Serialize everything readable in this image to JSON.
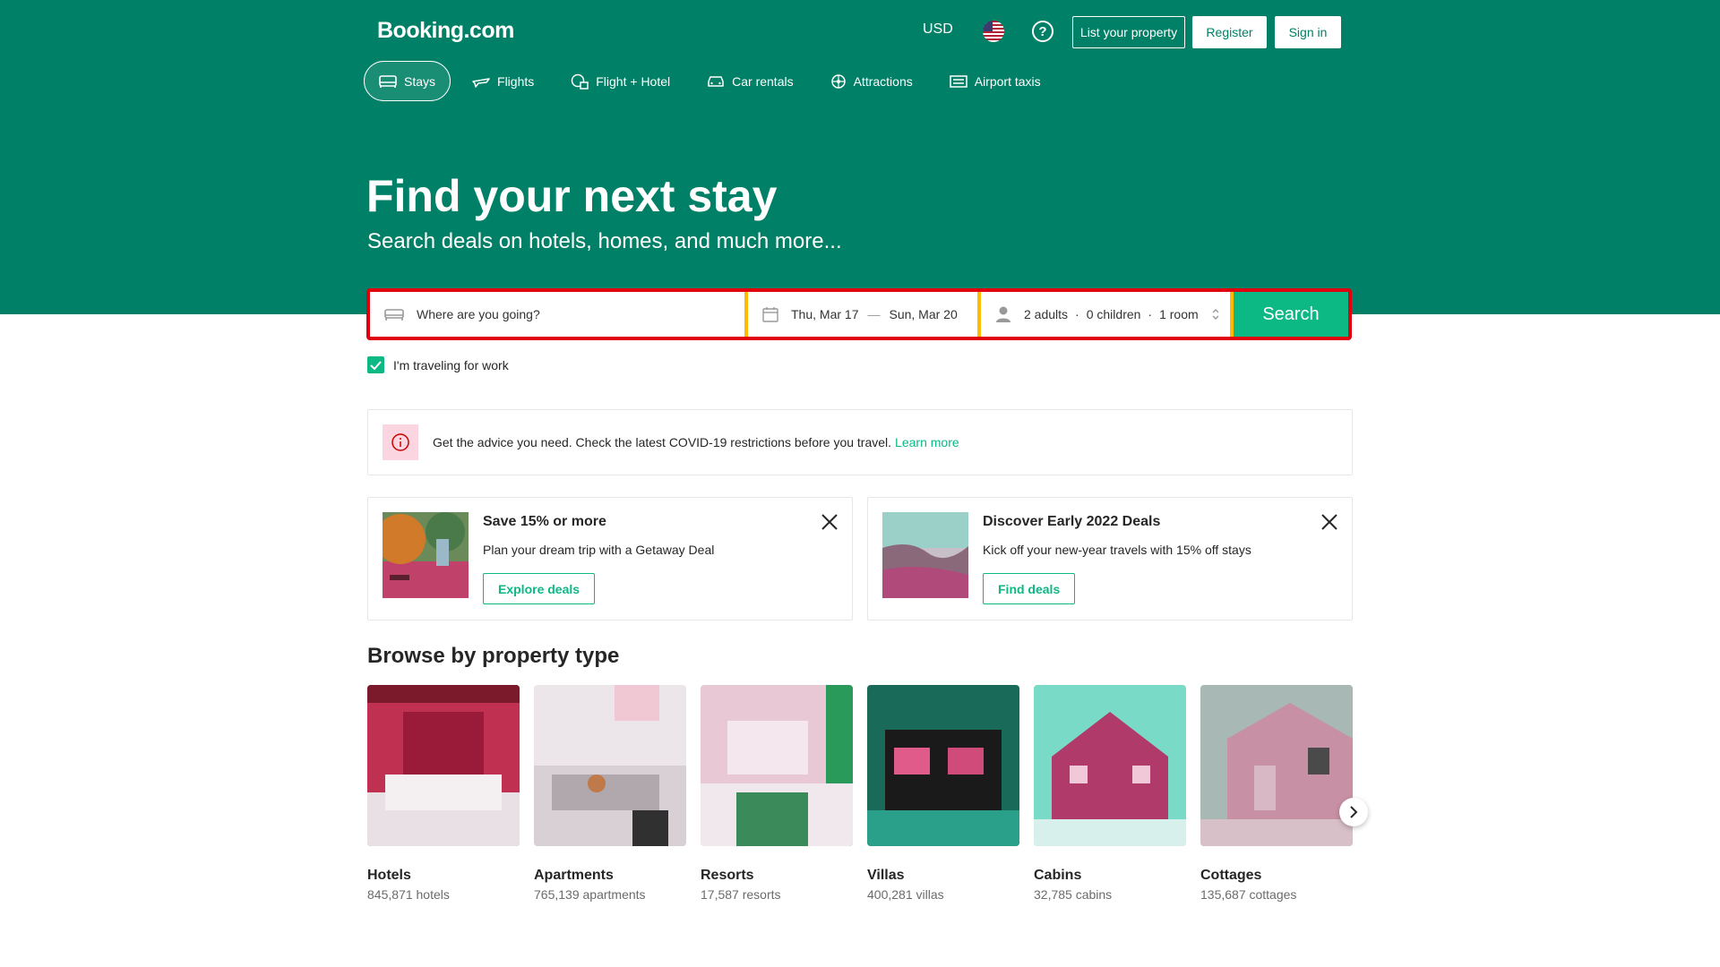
{
  "header": {
    "logo": "Booking.com",
    "currency": "USD",
    "help_label": "?",
    "list_property": "List your property",
    "register": "Register",
    "sign_in": "Sign in"
  },
  "nav": {
    "items": [
      {
        "label": "Stays",
        "icon": "bed-icon",
        "active": true
      },
      {
        "label": "Flights",
        "icon": "plane-icon"
      },
      {
        "label": "Flight + Hotel",
        "icon": "flight-hotel-icon"
      },
      {
        "label": "Car rentals",
        "icon": "car-icon"
      },
      {
        "label": "Attractions",
        "icon": "attractions-icon"
      },
      {
        "label": "Airport taxis",
        "icon": "taxi-icon"
      }
    ]
  },
  "hero": {
    "title": "Find your next stay",
    "subtitle": "Search deals on hotels, homes, and much more..."
  },
  "search": {
    "destination_placeholder": "Where are you going?",
    "checkin": "Thu, Mar 17",
    "date_separator": "—",
    "checkout": "Sun, Mar 20",
    "adults": "2 adults",
    "children": "0 children",
    "rooms": "1 room",
    "occ_separator": "·",
    "button": "Search",
    "work_label": "I'm traveling for work",
    "work_checked": true
  },
  "banner": {
    "text": "Get the advice you need. Check the latest COVID-19 restrictions before you travel.",
    "link": "Learn more"
  },
  "promos": [
    {
      "title": "Save 15% or more",
      "text": "Plan your dream trip with a Getaway Deal",
      "button": "Explore deals"
    },
    {
      "title": "Discover Early 2022 Deals",
      "text": "Kick off your new-year travels with 15% off stays",
      "button": "Find deals"
    }
  ],
  "browse": {
    "title": "Browse by property type",
    "types": [
      {
        "name": "Hotels",
        "count": "845,871 hotels"
      },
      {
        "name": "Apartments",
        "count": "765,139 apartments"
      },
      {
        "name": "Resorts",
        "count": "17,587 resorts"
      },
      {
        "name": "Villas",
        "count": "400,281 villas"
      },
      {
        "name": "Cabins",
        "count": "32,785 cabins"
      },
      {
        "name": "Cottages",
        "count": "135,687 cottages"
      }
    ]
  },
  "colors": {
    "brand": "#008066",
    "accent": "#0cb884",
    "highlight_border": "#e0000e"
  }
}
